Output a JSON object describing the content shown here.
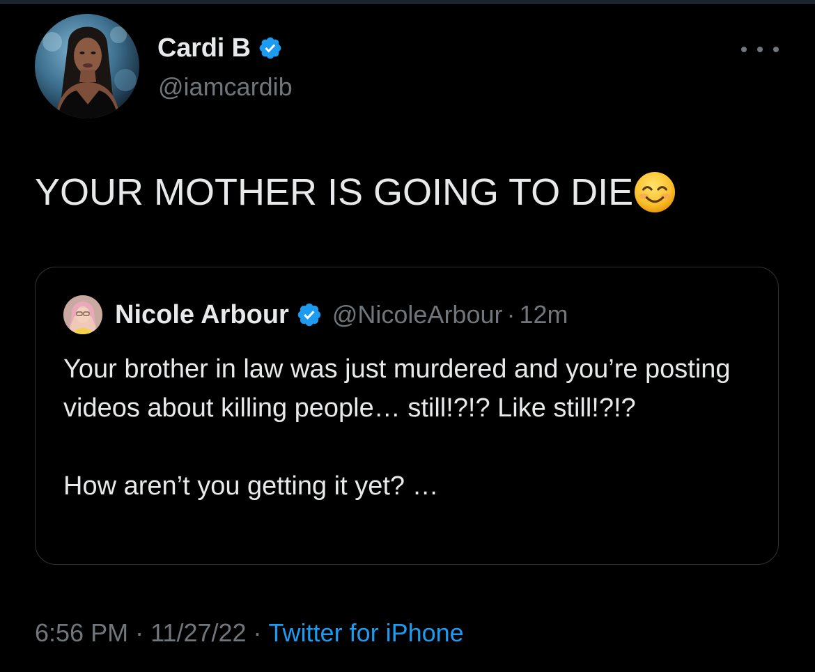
{
  "tweet": {
    "author": {
      "display_name": "Cardi B",
      "handle": "@iamcardib",
      "verified": true,
      "avatar": "profile-photo"
    },
    "text": "YOUR MOTHER IS GOING TO DIE",
    "emoji": "smiling-face-emoji",
    "more_icon": "more-options-icon"
  },
  "quoted_tweet": {
    "author": {
      "display_name": "Nicole Arbour",
      "handle": "@NicoleArbour",
      "verified": true,
      "avatar": "profile-photo"
    },
    "separator": "·",
    "time": "12m",
    "paragraphs": [
      "Your brother in law was just murdered and you’re posting videos about killing people… still!?!? Like still!?!?",
      "How aren’t you getting it yet? …"
    ]
  },
  "meta": {
    "time": "6:56 PM",
    "separator": "·",
    "date": "11/27/22",
    "source": "Twitter for iPhone"
  },
  "colors": {
    "background": "#000000",
    "primary_text": "#e7e9ea",
    "secondary_text": "#71767b",
    "accent": "#1d9bf0",
    "border": "#2f3336"
  }
}
